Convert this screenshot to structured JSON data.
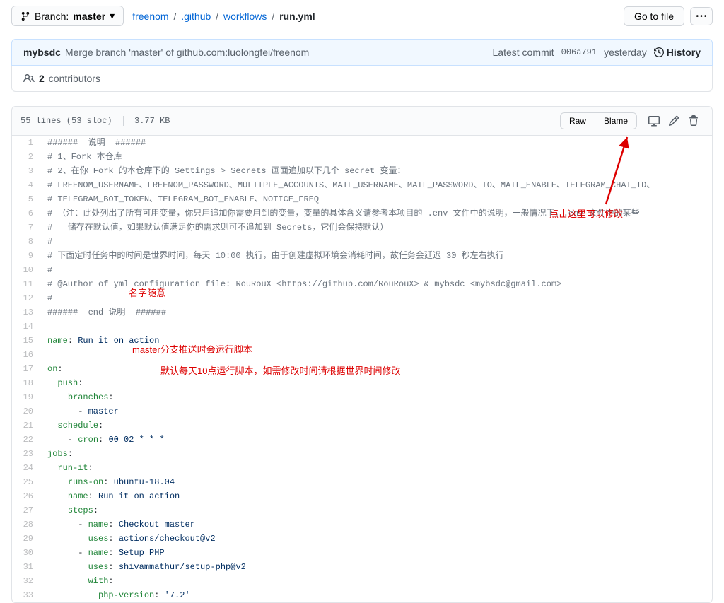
{
  "branch": {
    "label": "Branch:",
    "name": "master"
  },
  "breadcrumb": {
    "root": "freenom",
    "p1": ".github",
    "p2": "workflows",
    "file": "run.yml"
  },
  "goto_file": "Go to file",
  "commit": {
    "author": "mybsdc",
    "message": "Merge branch 'master' of github.com:luolongfei/freenom",
    "latest": "Latest commit",
    "hash": "006a791",
    "time": "yesterday",
    "history": "History"
  },
  "contributors": {
    "count": "2",
    "label": "contributors"
  },
  "file_header": {
    "lines": "55 lines (53 sloc)",
    "size": "3.77 KB",
    "raw": "Raw",
    "blame": "Blame"
  },
  "annotations": {
    "edit_here": "点击这里可以修改",
    "name_any": "名字随意",
    "master_branch": "master分支推送时会运行脚本",
    "cron_default": "默认每天10点运行脚本，如需修改时间请根据世界时间修改"
  },
  "code": [
    {
      "n": 1,
      "t": "######  说明  ######",
      "cls": "c-comment"
    },
    {
      "n": 2,
      "t": "# 1、Fork 本仓库",
      "cls": "c-comment"
    },
    {
      "n": 3,
      "t": "# 2、在你 Fork 的本仓库下的 Settings > Secrets 画面追加以下几个 secret 变量：",
      "cls": "c-comment"
    },
    {
      "n": 4,
      "t": "# FREENOM_USERNAME、FREENOM_PASSWORD、MULTIPLE_ACCOUNTS、MAIL_USERNAME、MAIL_PASSWORD、TO、MAIL_ENABLE、TELEGRAM_CHAT_ID、",
      "cls": "c-comment"
    },
    {
      "n": 5,
      "t": "# TELEGRAM_BOT_TOKEN、TELEGRAM_BOT_ENABLE、NOTICE_FREQ",
      "cls": "c-comment"
    },
    {
      "n": 6,
      "t": "# （注：此处列出了所有可用变量，你只用追加你需要用到的变量，变量的具体含义请参考本项目的 .env 文件中的说明，一般情况下，.env 文件中的某些",
      "cls": "c-comment"
    },
    {
      "n": 7,
      "t": "#   储存在默认值，如果默认值满足你的需求则可不追加到 Secrets，它们会保持默认）",
      "cls": "c-comment"
    },
    {
      "n": 8,
      "t": "#",
      "cls": "c-comment"
    },
    {
      "n": 9,
      "t": "# 下面定时任务中的时间是世界时间，每天 10:00 执行，由于创建虚拟环境会消耗时间，故任务会延迟 30 秒左右执行",
      "cls": "c-comment"
    },
    {
      "n": 10,
      "t": "#",
      "cls": "c-comment"
    },
    {
      "n": 11,
      "t": "# @Author of yml configuration file: RouRouX <https://github.com/RouRouX> & mybsdc <mybsdc@gmail.com>",
      "cls": "c-comment"
    },
    {
      "n": 12,
      "t": "#",
      "cls": "c-comment"
    },
    {
      "n": 13,
      "t": "######  end 说明  ######",
      "cls": "c-comment"
    },
    {
      "n": 14,
      "t": "",
      "cls": ""
    },
    {
      "n": 15,
      "h": "<span class='c-key'>name</span>: <span class='c-val'>Run it on action</span>"
    },
    {
      "n": 16,
      "t": "",
      "cls": ""
    },
    {
      "n": 17,
      "h": "<span class='c-key'>on</span>:"
    },
    {
      "n": 18,
      "h": "  <span class='c-key'>push</span>:"
    },
    {
      "n": 19,
      "h": "    <span class='c-key'>branches</span>:"
    },
    {
      "n": 20,
      "h": "      - <span class='c-val'>master</span>"
    },
    {
      "n": 21,
      "h": "  <span class='c-key'>schedule</span>:"
    },
    {
      "n": 22,
      "h": "    - <span class='c-key'>cron</span>: <span class='c-val'>00 02 * * *</span>"
    },
    {
      "n": 23,
      "h": "<span class='c-key'>jobs</span>:"
    },
    {
      "n": 24,
      "h": "  <span class='c-key'>run-it</span>:"
    },
    {
      "n": 25,
      "h": "    <span class='c-key'>runs-on</span>: <span class='c-val'>ubuntu-18.04</span>"
    },
    {
      "n": 26,
      "h": "    <span class='c-key'>name</span>: <span class='c-val'>Run it on action</span>"
    },
    {
      "n": 27,
      "h": "    <span class='c-key'>steps</span>:"
    },
    {
      "n": 28,
      "h": "      - <span class='c-key'>name</span>: <span class='c-val'>Checkout master</span>"
    },
    {
      "n": 29,
      "h": "        <span class='c-key'>uses</span>: <span class='c-val'>actions/checkout@v2</span>"
    },
    {
      "n": 30,
      "h": "      - <span class='c-key'>name</span>: <span class='c-val'>Setup PHP</span>"
    },
    {
      "n": 31,
      "h": "        <span class='c-key'>uses</span>: <span class='c-val'>shivammathur/setup-php@v2</span>"
    },
    {
      "n": 32,
      "h": "        <span class='c-key'>with</span>:"
    },
    {
      "n": 33,
      "h": "          <span class='c-key'>php-version</span>: <span class='c-val'>'7.2'</span>"
    }
  ]
}
